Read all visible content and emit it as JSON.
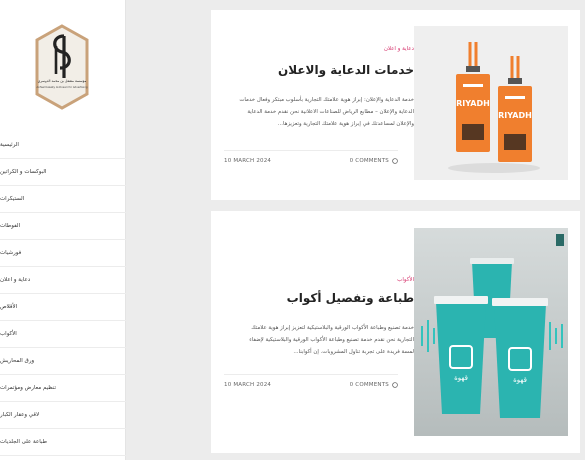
{
  "sidebar": {
    "logo": {
      "line1": "مؤسسة مشعل بن محمد الدوسري",
      "line2": "Anfaal Kawaty Al-Dosari for Advertising",
      "colors": {
        "frame": "#c9a27a",
        "fill": "#f2eee7",
        "ink": "#222222"
      }
    },
    "nav": [
      {
        "label": "الرئيسية"
      },
      {
        "label": "البوكسات و الكراتين"
      },
      {
        "label": "الستيكرات"
      },
      {
        "label": "الفوطات"
      },
      {
        "label": "فورشيات"
      },
      {
        "label": "دعاية و اعلان"
      },
      {
        "label": "الأقلاص"
      },
      {
        "label": "الأكواب"
      },
      {
        "label": "ورق المحاريش"
      },
      {
        "label": "تنظيم معارض ومؤتمرات"
      },
      {
        "label": "لاقي وعقار الكبار"
      },
      {
        "label": "طباعة على الجلديات"
      }
    ]
  },
  "posts": [
    {
      "category": "دعاية و اعلان",
      "title": "خدمات الدعاية والاعلان",
      "excerpt": "خدمة الدعاية والإعلان: إبراز هوية علامتك التجارية بأسلوب مبتكر وفعال خدمات الدعاية والإعلان – مطابع الرياض للصناعات الاعلانية نحن نقدم خدمة الدعاية والإعلان لمساعدتك في إبراز هوية علامتك التجارية وتعزيزها...",
      "comments": "0 COMMENTS",
      "date": "10 MARCH 2024",
      "image": "orange lanyard id badges",
      "badge_text": "RIYADH"
    },
    {
      "category": "الأكواب",
      "title": "طباعة وتفصيل أكواب",
      "excerpt": "خدمة تصنيع وطباعة الأكواب الورقية والبلاستيكية لتعزيز إبراز هوية علامتك التجارية نحن نقدم خدمة تصنيع وطباعة الأكواب الورقية والبلاستيكية لإضفاء لمسة فريدة على تجربة تناول المشروبات. إن أكوابنا...",
      "comments": "0 COMMENTS",
      "date": "10 MARCH 2024",
      "image": "teal printed paper cups",
      "cup_text": "قهوة"
    }
  ],
  "colors": {
    "accent": "#d6336c",
    "orange": "#f07f2e",
    "teal": "#2bb4b0"
  }
}
